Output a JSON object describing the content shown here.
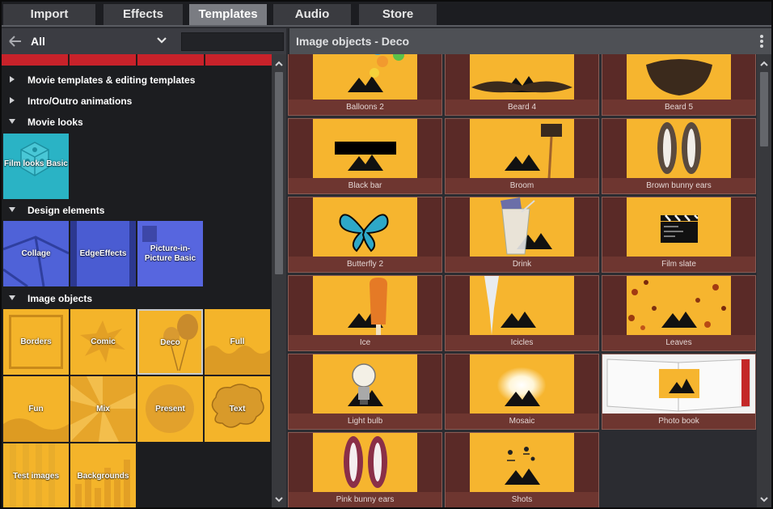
{
  "tabs": [
    {
      "label": "Import",
      "active": false
    },
    {
      "label": "Effects",
      "active": false
    },
    {
      "label": "Templates",
      "active": true
    },
    {
      "label": "Audio",
      "active": false
    },
    {
      "label": "Store",
      "active": false
    }
  ],
  "left_header": {
    "category": "All",
    "search_value": ""
  },
  "right_header": {
    "title": "Image objects - Deco"
  },
  "categories": [
    {
      "label": "Movie templates & editing templates",
      "expanded": false
    },
    {
      "label": "Intro/Outro animations",
      "expanded": false
    },
    {
      "label": "Movie looks",
      "expanded": true
    },
    {
      "label": "Design elements",
      "expanded": true
    },
    {
      "label": "Image objects",
      "expanded": true
    }
  ],
  "movie_looks": [
    {
      "label": "Film looks Basic",
      "color": "#2ab3c5"
    }
  ],
  "design_elements": [
    {
      "label": "Collage",
      "color": "#4f62d8"
    },
    {
      "label": "EdgeEffects",
      "color": "#4a5cd2"
    },
    {
      "label": "Picture-in-Picture Basic",
      "color": "#5766df"
    }
  ],
  "image_objects": [
    {
      "label": "Borders"
    },
    {
      "label": "Comic"
    },
    {
      "label": "Deco",
      "selected": true
    },
    {
      "label": "Full"
    },
    {
      "label": "Fun"
    },
    {
      "label": "Mix"
    },
    {
      "label": "Present"
    },
    {
      "label": "Text"
    },
    {
      "label": "Test images"
    },
    {
      "label": "Backgrounds"
    }
  ],
  "items": [
    {
      "label": "Balloons 2",
      "icon": "balloons-icon"
    },
    {
      "label": "Beard 4",
      "icon": "beard-icon"
    },
    {
      "label": "Beard 5",
      "icon": "beard-icon"
    },
    {
      "label": "Black bar",
      "icon": "black-bar-icon"
    },
    {
      "label": "Broom",
      "icon": "broom-icon"
    },
    {
      "label": "Brown bunny ears",
      "icon": "bunny-ears-icon"
    },
    {
      "label": "Butterfly 2",
      "icon": "butterfly-icon"
    },
    {
      "label": "Drink",
      "icon": "drink-icon"
    },
    {
      "label": "Film slate",
      "icon": "film-slate-icon"
    },
    {
      "label": "Ice",
      "icon": "ice-lolly-icon"
    },
    {
      "label": "Icicles",
      "icon": "icicle-icon"
    },
    {
      "label": "Leaves",
      "icon": "leaves-icon"
    },
    {
      "label": "Light bulb",
      "icon": "light-bulb-icon"
    },
    {
      "label": "Mosaic",
      "icon": "mosaic-icon"
    },
    {
      "label": "Photo book",
      "icon": "photo-book-icon"
    },
    {
      "label": "Pink bunny ears",
      "icon": "bunny-ears-icon"
    },
    {
      "label": "Shots",
      "icon": "shots-icon"
    }
  ],
  "colors": {
    "accent_active_tab": "#7a7c82",
    "thumb_yellow": "#f6b52f",
    "caption_bg": "#6e3630"
  }
}
